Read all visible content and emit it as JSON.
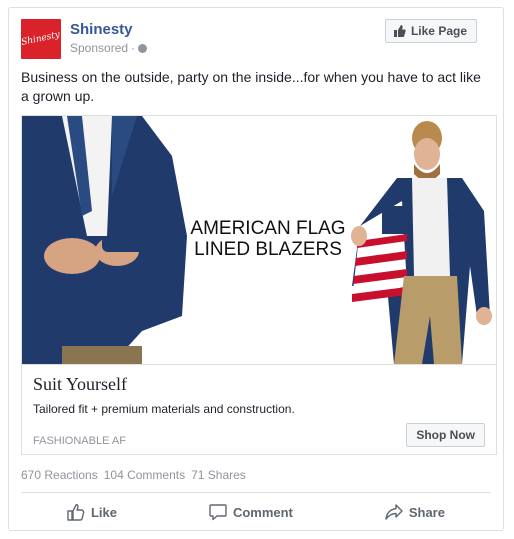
{
  "post": {
    "page_name": "Shinesty",
    "logo_text": "Shinesty",
    "sponsored_label": "Sponsored",
    "separator": "·",
    "like_page_label": "Like Page",
    "text": "Business on the outside, party on the inside...for when you have to act like a grown up."
  },
  "ad": {
    "image_text_line1": "AMERICAN FLAG",
    "image_text_line2": "LINED BLAZERS",
    "title": "Suit Yourself",
    "description": "Tailored fit + premium materials and construction.",
    "domain": "FASHIONABLE AF",
    "cta_label": "Shop Now"
  },
  "stats": {
    "reactions": "670 Reactions",
    "comments": "104 Comments",
    "shares": "71 Shares"
  },
  "actions": {
    "like": "Like",
    "comment": "Comment",
    "share": "Share"
  },
  "colors": {
    "brand_red": "#d9222a",
    "link_blue": "#365899",
    "navy_blazer": "#1f3a6b",
    "flag_red": "#c8102e"
  }
}
